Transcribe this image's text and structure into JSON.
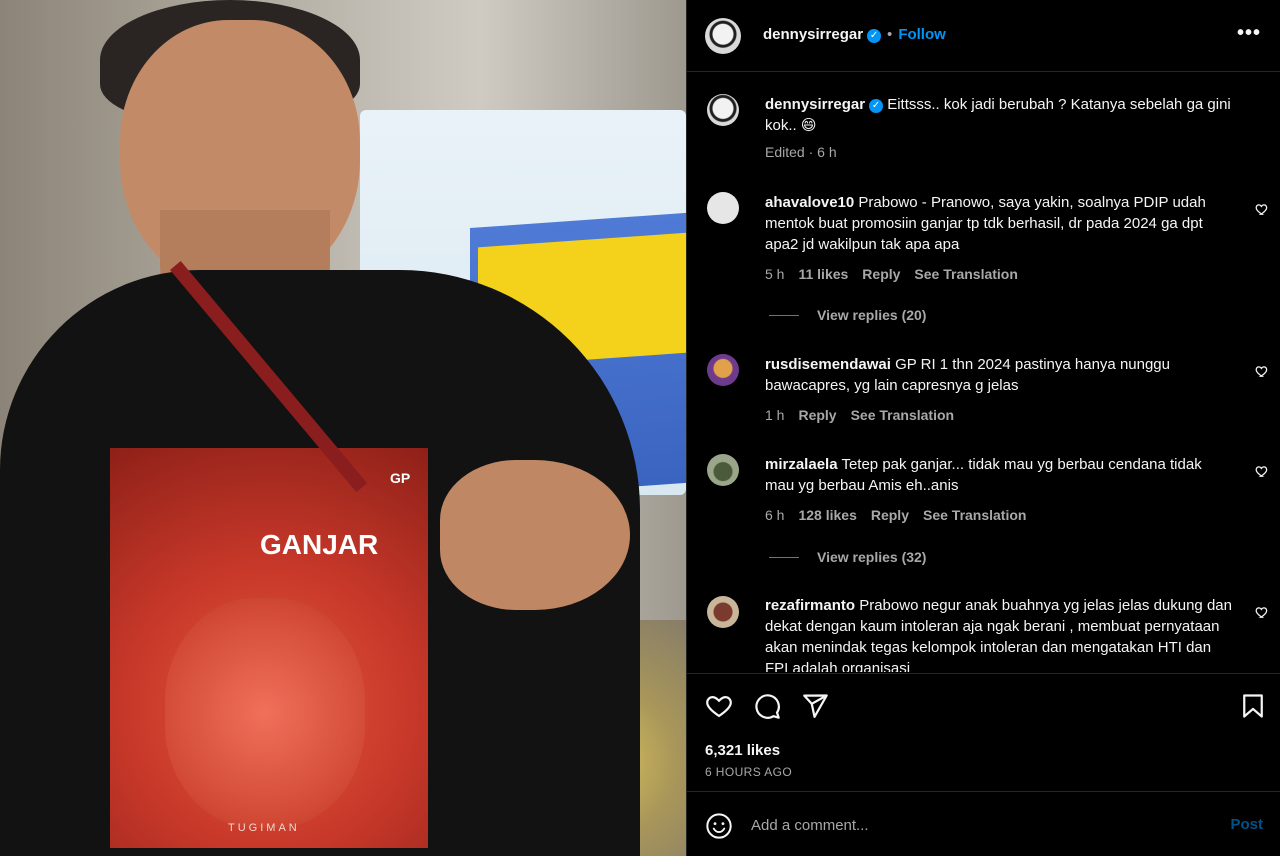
{
  "post_image": {
    "shirt_text_ganjar": "GANJAR",
    "shirt_text_gp": "GP",
    "shirt_text_bottom": "TUGIMAN"
  },
  "header": {
    "username": "dennysirregar",
    "follow_label": "Follow",
    "more_label": "•••"
  },
  "caption": {
    "username": "dennysirregar",
    "text": "Eittsss.. kok jadi berubah ? Katanya sebelah ga gini kok.. 😄",
    "meta": "Edited · 6 h"
  },
  "comments": [
    {
      "username": "ahavalove10",
      "text": "Prabowo - Pranowo, saya yakin, soalnya PDIP udah mentok buat promosiin ganjar tp tdk berhasil, dr pada 2024 ga dpt apa2 jd wakilpun tak apa apa",
      "time": "5 h",
      "likes": "11 likes",
      "reply": "Reply",
      "translate": "See Translation",
      "view_replies": "View replies (20)"
    },
    {
      "username": "rusdisemendawai",
      "text": "GP RI 1 thn 2024 pastinya hanya nunggu bawacapres, yg lain capresnya g jelas",
      "time": "1 h",
      "reply": "Reply",
      "translate": "See Translation"
    },
    {
      "username": "mirzalaela",
      "text": "Tetep pak ganjar... tidak mau yg berbau cendana tidak mau yg berbau Amis eh..anis",
      "time": "6 h",
      "likes": "128 likes",
      "reply": "Reply",
      "translate": "See Translation",
      "view_replies": "View replies (32)"
    },
    {
      "username": "rezafirmanto",
      "text": "Prabowo negur anak buahnya yg jelas jelas dukung dan dekat dengan kaum intoleran aja ngak berani , membuat pernyataan akan menindak tegas kelompok intoleran dan mengatakan HTI dan FPI adalah organisasi"
    }
  ],
  "actions": {
    "likes": "6,321 likes",
    "time_ago": "6 HOURS AGO"
  },
  "add_comment": {
    "placeholder": "Add a comment...",
    "post_label": "Post"
  },
  "colors": {
    "accent": "#0095f6",
    "secondary_text": "#a8a8a8",
    "divider": "#262626"
  }
}
